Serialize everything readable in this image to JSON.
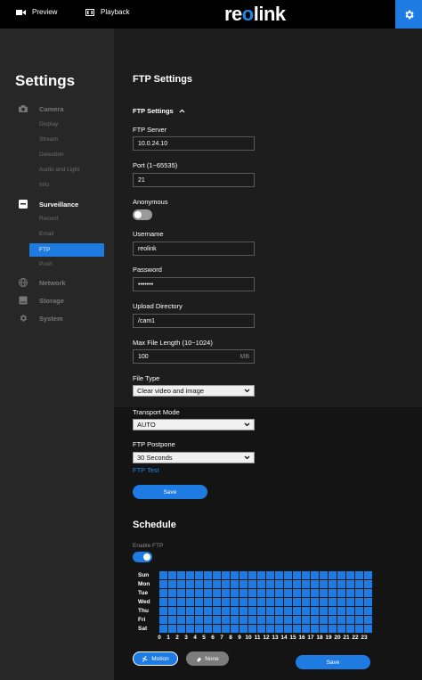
{
  "topbar": {
    "preview_label": "Preview",
    "playback_label": "Playback",
    "logo_text_left": "re",
    "logo_text_o": "o",
    "logo_text_right": "link"
  },
  "sidebar": {
    "title": "Settings",
    "categories": [
      {
        "label": "Camera",
        "icon": "camera-icon",
        "subs": [
          "Display",
          "Stream",
          "Detection",
          "Audio and Light",
          "Info"
        ]
      },
      {
        "label": "Surveillance",
        "icon": "surveillance-icon",
        "subs": [
          "Record",
          "Email",
          "FTP",
          "Push"
        ]
      },
      {
        "label": "Network",
        "icon": "globe-icon"
      },
      {
        "label": "Storage",
        "icon": "storage-icon"
      },
      {
        "label": "System",
        "icon": "gear-icon"
      }
    ],
    "active_category": "Surveillance",
    "active_sub": "FTP"
  },
  "main": {
    "page_title": "FTP Settings",
    "section_title": "FTP Settings",
    "ftp_server": {
      "label": "FTP Server",
      "value": "10.0.24.10"
    },
    "port": {
      "label": "Port (1~65535)",
      "value": "21"
    },
    "anonymous": {
      "label": "Anonymous",
      "enabled": false
    },
    "username": {
      "label": "Username",
      "value": "reolink"
    },
    "password": {
      "label": "Password",
      "value": "•••••••"
    },
    "upload_dir": {
      "label": "Upload Directory",
      "value": "/cam1"
    },
    "max_file": {
      "label": "Max File Length (10~1024)",
      "value": "100",
      "unit": "MB"
    },
    "file_type": {
      "label": "File Type",
      "value": "Clear video and image"
    },
    "transport": {
      "label": "Transport Mode",
      "value": "AUTO"
    },
    "postpone": {
      "label": "FTP Postpone",
      "value": "30 Seconds"
    },
    "ftp_test_label": "FTP Test",
    "save_label": "Save"
  },
  "schedule": {
    "title": "Schedule",
    "enable_label": "Enable FTP",
    "enabled": true,
    "days": [
      "Sun",
      "Mon",
      "Tue",
      "Wed",
      "Thu",
      "Fri",
      "Sat"
    ],
    "hours": [
      "0",
      "1",
      "2",
      "3",
      "4",
      "5",
      "6",
      "7",
      "8",
      "9",
      "10",
      "11",
      "12",
      "13",
      "14",
      "15",
      "16",
      "17",
      "18",
      "19",
      "20",
      "21",
      "22",
      "23"
    ],
    "motion_label": "Motion",
    "none_label": "None",
    "save_label": "Save"
  },
  "colors": {
    "accent": "#1e7be2",
    "toggle_off": "#9a9a9a"
  }
}
